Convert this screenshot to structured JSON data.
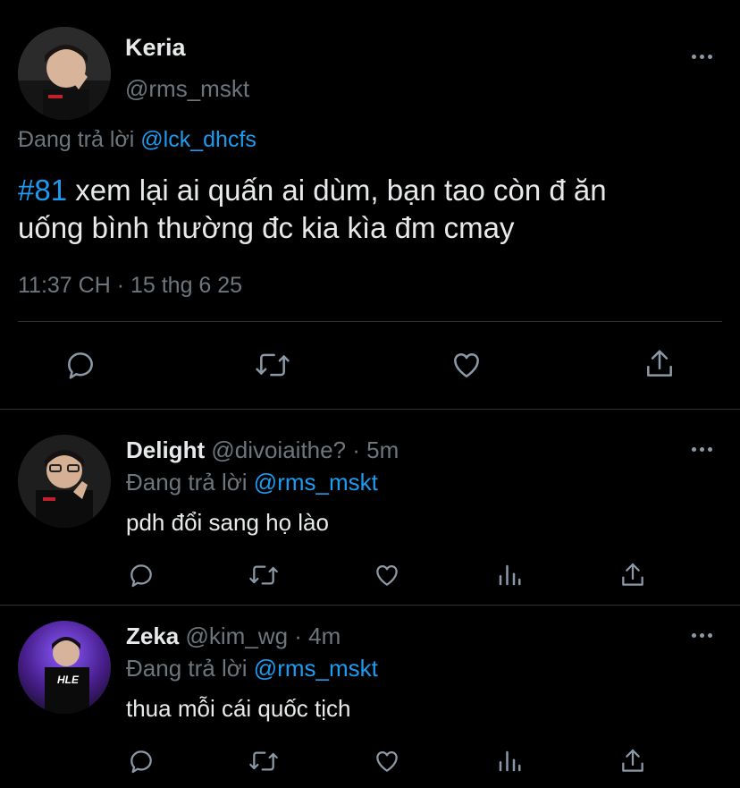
{
  "main_tweet": {
    "display_name": "Keria",
    "handle": "@rms_mskt",
    "replying_prefix": "Đang trả lời",
    "replying_to": "@lck_dhcfs",
    "hashtag": "#81",
    "text_rest_line1": " xem lại ai quấn ai dùm, bạn tao còn đ ăn",
    "text_line2": "uống bình thường đc kia kìa đm cmay",
    "timestamp": "11:37 CH · 15 thg 6 25",
    "actions": [
      "reply-icon",
      "retweet-icon",
      "like-icon",
      "share-icon"
    ]
  },
  "replies": [
    {
      "display_name": "Delight",
      "handle": "@divoiaithe?",
      "age": "· 5m",
      "replying_prefix": "Đang trả lời",
      "replying_to": "@rms_mskt",
      "text": "pdh đổi sang họ lào",
      "actions": [
        "reply-icon",
        "retweet-icon",
        "like-icon",
        "analytics-icon",
        "share-icon"
      ]
    },
    {
      "display_name": "Zeka",
      "handle": "@kim_wg",
      "age": "· 4m",
      "replying_prefix": "Đang trả lời",
      "replying_to": "@rms_mskt",
      "text": "thua mỗi cái quốc tịch",
      "actions": [
        "reply-icon",
        "retweet-icon",
        "like-icon",
        "analytics-icon",
        "share-icon"
      ]
    }
  ],
  "colors": {
    "background": "#000000",
    "text": "#e7e9ea",
    "secondary": "#6e767d",
    "link": "#1d9bf0",
    "divider": "#2f3336"
  }
}
